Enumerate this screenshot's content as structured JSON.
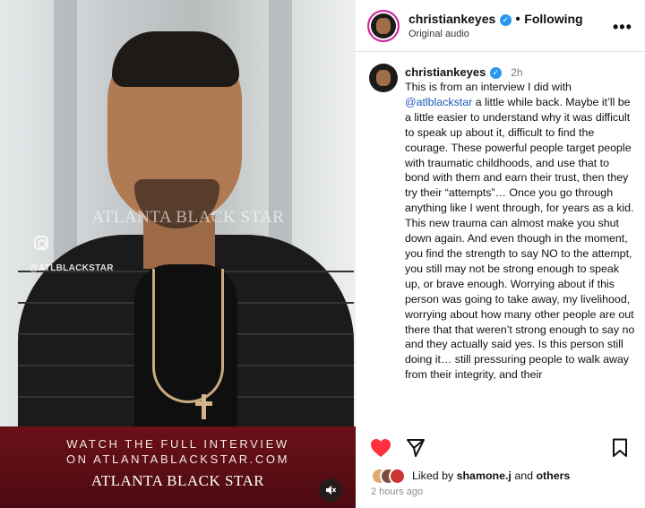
{
  "media": {
    "watermark": "ATLANTA BLACK STAR",
    "watermark_handle": "@ATLBLACKSTAR",
    "banner_line1": "WATCH THE FULL INTERVIEW",
    "banner_line2": "ON ATLANTABLACKSTAR.COM",
    "banner_logo": "ATLANTA BLACK STAR",
    "mute_icon": "speaker-muted-icon"
  },
  "header": {
    "username": "christiankeyes",
    "separator": "•",
    "follow_status": "Following",
    "audio_label": "Original audio",
    "more_icon": "•••"
  },
  "post": {
    "username": "christiankeyes",
    "time": "2h",
    "caption_before_mention": "This is from an interview I did with ",
    "mention": "@atlblackstar",
    "caption_after_mention": " a little while back. Maybe it’ll be a little easier to understand why it was difficult to speak up about it, difficult to find the courage. These powerful people target people with traumatic childhoods, and use that to bond with them and earn their trust, then they try their “attempts”… Once you go through anything like I went through, for years as a kid. This new trauma can almost make you shut down again. And even though in the moment, you find the strength to say NO to the attempt, you still may not be strong enough to speak up, or brave enough. Worrying about if this person was going to take away, my livelihood, worrying about how many other people are out there that that weren’t strong enough to say no and they actually said yes. Is this person still doing it… still pressuring people to walk away from their integrity, and their"
  },
  "likes": {
    "prefix": "Liked by ",
    "user": "shamone.j",
    "middle": " and ",
    "others": "others"
  },
  "timestamp": "2 hours ago",
  "colors": {
    "heart": "#ff3040",
    "verified": "#2b96f1",
    "mention": "#1d5bb5",
    "banner": "#5e0f15"
  }
}
